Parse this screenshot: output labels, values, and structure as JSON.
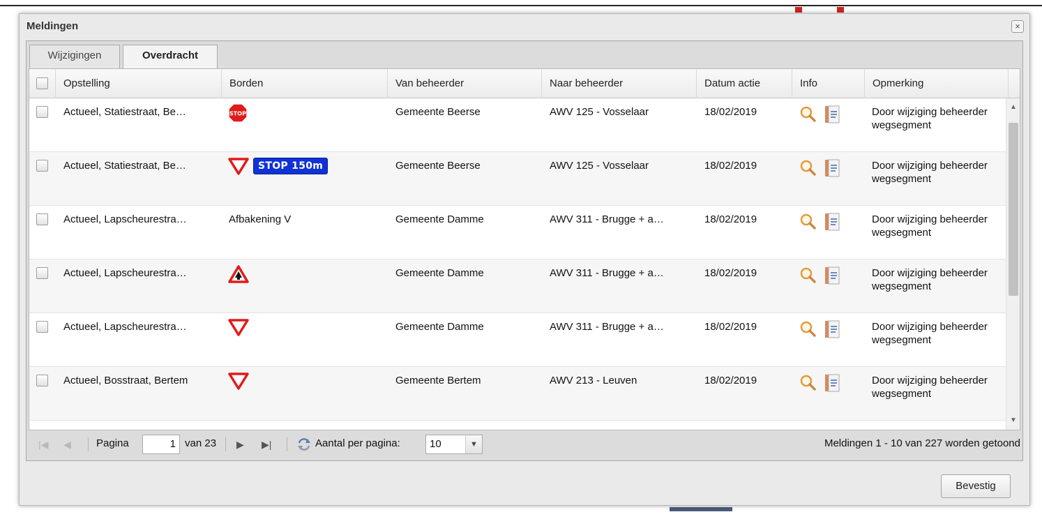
{
  "dialog": {
    "title": "Meldingen",
    "close_symbol": "×"
  },
  "tabs": [
    {
      "label": "Wijzigingen",
      "active": false
    },
    {
      "label": "Overdracht",
      "active": true
    }
  ],
  "columns": [
    "Opstelling",
    "Borden",
    "Van beheerder",
    "Naar beheerder",
    "Datum actie",
    "Info",
    "Opmerking"
  ],
  "rows": [
    {
      "opstelling": "Actueel, Statiestraat, Be…",
      "borden": {
        "icons": [
          "stop-sign-icon"
        ],
        "text": ""
      },
      "van": "Gemeente Beerse",
      "naar": "AWV 125 - Vosselaar",
      "datum": "18/02/2019",
      "opmerking": "Door wijziging beheerder wegsegment"
    },
    {
      "opstelling": "Actueel, Statiestraat, Be…",
      "borden": {
        "icons": [
          "yield-sign-icon",
          "stop-distance-sign-icon"
        ],
        "text": "STOP 150m"
      },
      "van": "Gemeente Beerse",
      "naar": "AWV 125 - Vosselaar",
      "datum": "18/02/2019",
      "opmerking": "Door wijziging beheerder wegsegment"
    },
    {
      "opstelling": "Actueel, Lapscheurestra…",
      "borden": {
        "icons": [],
        "text": "Afbakening V"
      },
      "van": "Gemeente Damme",
      "naar": "AWV 311 - Brugge + a…",
      "datum": "18/02/2019",
      "opmerking": "Door wijziging beheerder wegsegment"
    },
    {
      "opstelling": "Actueel, Lapscheurestra…",
      "borden": {
        "icons": [
          "warning-triangle-icon"
        ],
        "text": ""
      },
      "van": "Gemeente Damme",
      "naar": "AWV 311 - Brugge + a…",
      "datum": "18/02/2019",
      "opmerking": "Door wijziging beheerder wegsegment"
    },
    {
      "opstelling": "Actueel, Lapscheurestra…",
      "borden": {
        "icons": [
          "yield-sign-icon"
        ],
        "text": ""
      },
      "van": "Gemeente Damme",
      "naar": "AWV 311 - Brugge + a…",
      "datum": "18/02/2019",
      "opmerking": "Door wijziging beheerder wegsegment"
    },
    {
      "opstelling": "Actueel, Bosstraat, Bertem",
      "borden": {
        "icons": [
          "yield-sign-icon"
        ],
        "text": ""
      },
      "van": "Gemeente Bertem",
      "naar": "AWV 213 - Leuven",
      "datum": "18/02/2019",
      "opmerking": "Door wijziging beheerder wegsegment"
    }
  ],
  "stop_sign_text": "STOP",
  "pager": {
    "page_label": "Pagina",
    "page_value": "1",
    "of_label": "van 23",
    "per_page_label": "Aantal per pagina:",
    "per_page_value": "10",
    "status": "Meldingen 1 - 10 van 227 worden getoond"
  },
  "footer": {
    "confirm_label": "Bevestig"
  },
  "colors": {
    "sign_red": "#e01b1b",
    "sign_blue": "#1032d6",
    "info_orange": "#e49a3a"
  }
}
